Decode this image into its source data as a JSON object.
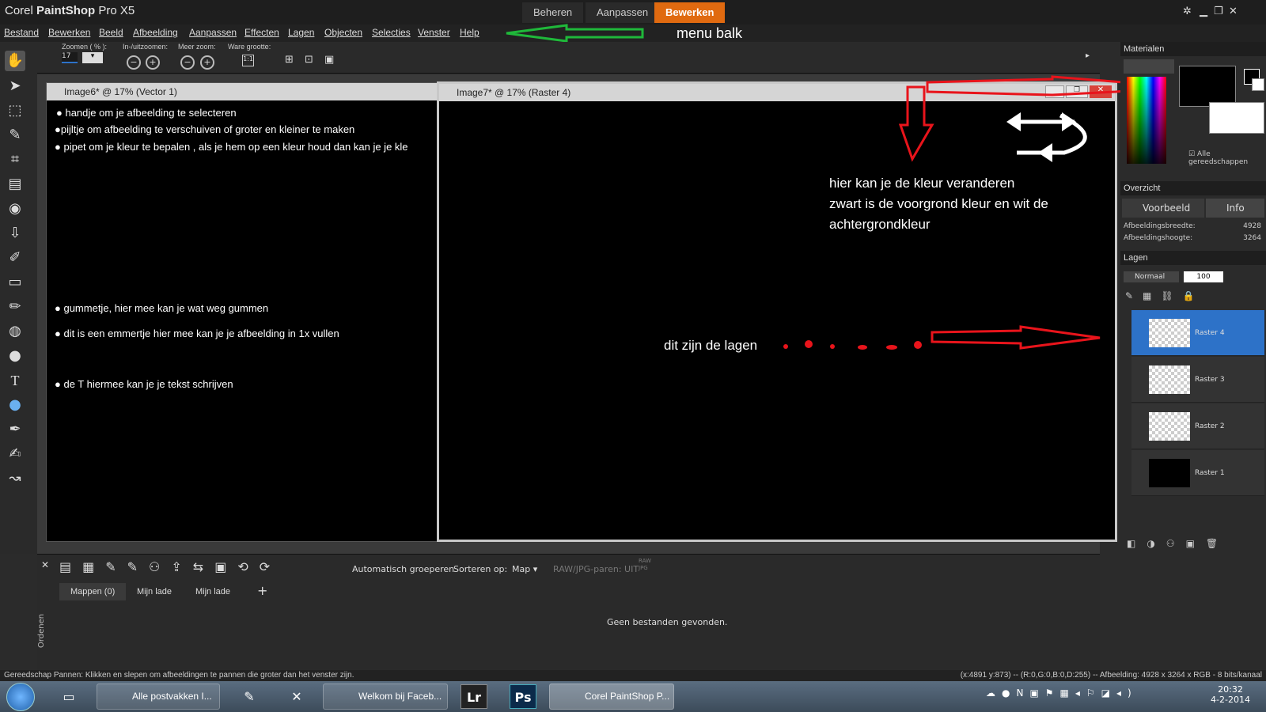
{
  "app": {
    "title_prefix": "Corel ",
    "title_bold": "PaintShop",
    "title_suffix": " Pro X5"
  },
  "workspace_tabs": [
    {
      "label": "Beheren"
    },
    {
      "label": "Aanpassen"
    },
    {
      "label": "Bewerken"
    }
  ],
  "menu": [
    "Bestand",
    "Bewerken",
    "Beeld",
    "Afbeelding",
    "Aanpassen",
    "Effecten",
    "Lagen",
    "Objecten",
    "Selecties",
    "Venster",
    "Help"
  ],
  "menu_annotation": "menu balk",
  "toolbar": {
    "zoom_label": "Zoomen ( % ):",
    "zoom_value": "17",
    "inout_label": "In-/uitzoomen:",
    "more_zoom_label": "Meer zoom:",
    "actual_size_label": "Ware grootte:"
  },
  "doc1": {
    "title": "Image6* @  17% (Vector 1)",
    "lines": [
      "handje om je afbeelding te selecteren",
      "pijltje om afbeelding te verschuiven of groter en kleiner te maken",
      "pipet om je kleur te bepalen , als je hem op een kleur houd dan kan je je kle",
      "gummetje, hier mee kan je wat weg gummen",
      "dit is een emmertje hier mee kan je je afbeelding in 1x vullen",
      "de T hiermee kan je je tekst schrijven"
    ]
  },
  "doc2": {
    "title": "Image7* @  17% (Raster 4)",
    "annotation_lines": [
      "hier kan je de kleur veranderen",
      "zwart is de voorgrond kleur en wit de",
      "achtergrondkleur"
    ],
    "layers_annotation": "dit zijn de lagen"
  },
  "materials": {
    "title": "Materialen",
    "all_tools": "Alle gereedschappen"
  },
  "overview": {
    "title": "Overzicht",
    "tab_preview": "Voorbeeld",
    "tab_info": "Info",
    "width_label": "Afbeeldingsbreedte:",
    "width_value": "4928",
    "height_label": "Afbeeldingshoogte:",
    "height_value": "3264"
  },
  "layers": {
    "title": "Lagen",
    "blend_mode": "Normaal",
    "opacity": "100",
    "items": [
      {
        "name": "Raster 4"
      },
      {
        "name": "Raster 3"
      },
      {
        "name": "Raster 2"
      },
      {
        "name": "Raster 1"
      }
    ]
  },
  "organizer": {
    "auto_group": "Automatisch groeperen",
    "sort_label": "Sorteren op:",
    "sort_value": "Map",
    "raw_jpg": "RAW/JPG-paren: UIT",
    "raw_icon_text_1": "RAW",
    "raw_icon_text_2": "JPG",
    "tabs": [
      "Mappen (0)",
      "Mijn lade",
      "Mijn lade"
    ],
    "side_label": "Ordenen",
    "empty_text": "Geen bestanden gevonden."
  },
  "status": {
    "left": "Gereedschap Pannen: Klikken en slepen om afbeeldingen te pannen die groter dan het venster zijn.",
    "right": "(x:4891 y:873) -- (R:0,G:0,B:0,D:255) -- Afbeelding:  4928 x 3264 x RGB - 8 bits/kanaal"
  },
  "taskbar": {
    "items": [
      "Alle postvakken I...",
      "Welkom bij Faceb...",
      "Corel PaintShop P..."
    ],
    "lr_label": "Lr",
    "ps_label": "Ps",
    "time": "20:32",
    "date": "4-2-2014"
  },
  "colors": {
    "accent": "#e06a10",
    "arrow_red": "#e8141b",
    "arrow_green": "#1fb83a",
    "layer_selected": "#2d72c8"
  }
}
